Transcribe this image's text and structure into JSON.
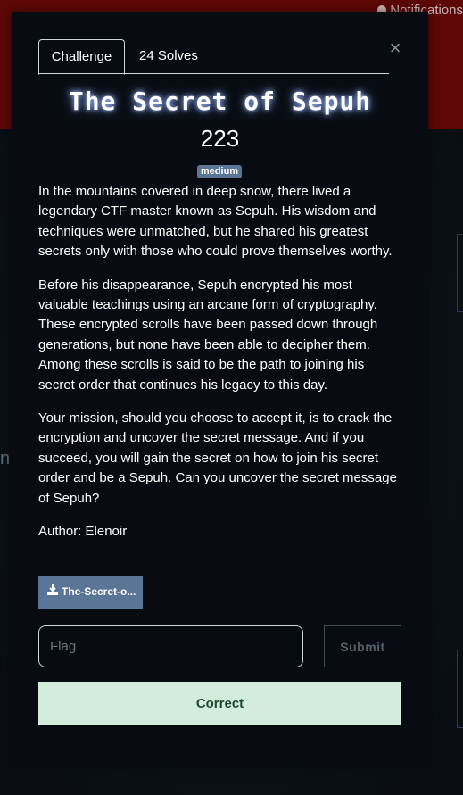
{
  "background": {
    "notification_label": "Notifications",
    "edge_letter": "n"
  },
  "modal": {
    "tabs": [
      {
        "label": "Challenge",
        "active": true
      },
      {
        "label": "24 Solves",
        "active": false
      }
    ],
    "close_glyph": "×",
    "title": "The Secret of Sepuh",
    "value": "223",
    "difficulty": "medium",
    "description": [
      "In the mountains covered in deep snow, there lived a legendary CTF master known as Sepuh. His wisdom and techniques were unmatched, but he shared his greatest secrets only with those who could prove themselves worthy.",
      "Before his disappearance, Sepuh encrypted his most valuable teachings using an arcane form of cryptography. These encrypted scrolls have been passed down through generations, but none have been able to decipher them. Among these scrolls is said to be the path to joining his secret order that continues his legacy to this day.",
      "Your mission, should you choose to accept it, is to crack the encryption and uncover the secret message. And if you succeed, you will gain the secret on how to join his secret order and be a Sepuh. Can you uncover the secret message of Sepuh?"
    ],
    "author": "Author: Elenoir",
    "file_label": "The-Secret-o...",
    "flag_placeholder": "Flag",
    "flag_value": "",
    "submit_label": "Submit",
    "result_message": "Correct"
  },
  "colors": {
    "accent_badge": "#5a7595",
    "success_bg": "#d4ecdb",
    "success_text": "#1f4a2e",
    "header_red": "#7e0a0a"
  }
}
